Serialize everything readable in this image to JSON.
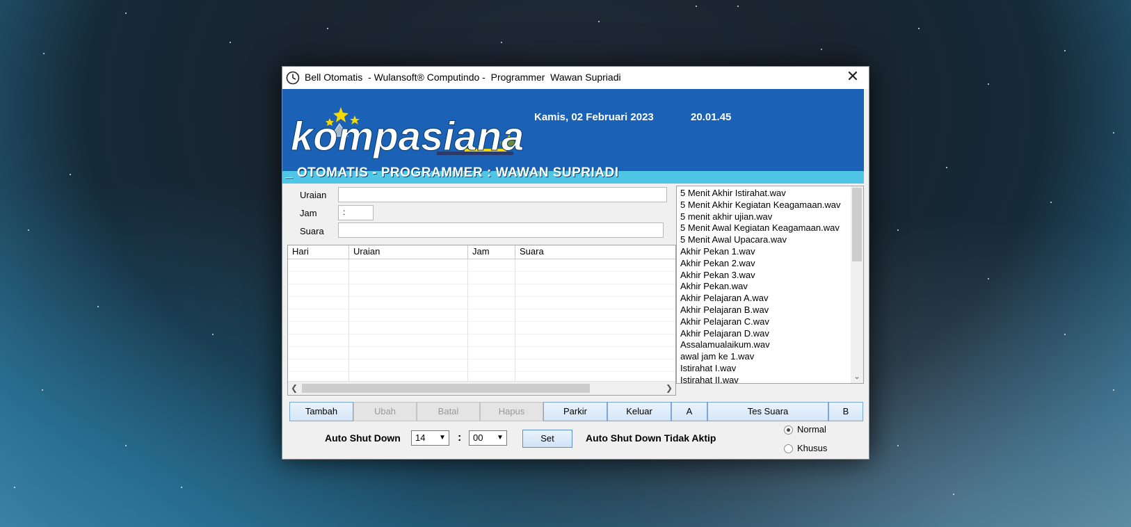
{
  "window": {
    "title": "Bell Otomatis  - Wulansoft® Computindo -  Programmer  Wawan Supriadi",
    "close_glyph": "✕"
  },
  "banner": {
    "logo_text": "kompasiana",
    "date": "Kamis, 02 Februari 2023",
    "time": "20.01.45",
    "marquee": "_ OTOMATIS - PROGRAMMER : WAWAN SUPRIADI"
  },
  "form": {
    "uraian_label": "Uraian",
    "jam_label": "Jam",
    "suara_label": "Suara",
    "uraian_value": "",
    "jam_value": ":",
    "suara_value": ""
  },
  "grid": {
    "columns": [
      "Hari",
      "Uraian",
      "Jam",
      "Suara"
    ],
    "rows": []
  },
  "files": [
    "5 Menit Akhir Istirahat.wav",
    "5 Menit Akhir Kegiatan Keagamaan.wav",
    "5 menit akhir ujian.wav",
    "5 Menit Awal Kegiatan Keagamaan.wav",
    "5 Menit Awal Upacara.wav",
    "Akhir Pekan 1.wav",
    "Akhir Pekan 2.wav",
    "Akhir Pekan 3.wav",
    "Akhir Pekan.wav",
    "Akhir Pelajaran A.wav",
    "Akhir Pelajaran B.wav",
    "Akhir Pelajaran C.wav",
    "Akhir Pelajaran D.wav",
    "Assalamualaikum.wav",
    "awal jam ke 1.wav",
    "Istirahat I.wav",
    "Istirahat II.wav"
  ],
  "buttons": {
    "tambah": "Tambah",
    "ubah": "Ubah",
    "batal": "Batal",
    "hapus": "Hapus",
    "parkir": "Parkir",
    "keluar": "Keluar",
    "a": "A",
    "tes_suara": "Tes Suara",
    "b": "B"
  },
  "shutdown": {
    "label": "Auto Shut Down",
    "hour": "14",
    "separator": ":",
    "minute": "00",
    "set_label": "Set",
    "status": "Auto Shut Down Tidak Aktip",
    "mode_normal": "Normal",
    "mode_khusus": "Khusus",
    "selected_mode": "Normal"
  },
  "colors": {
    "banner_blue": "#1b62b6",
    "banner_strip": "#4fc6e6",
    "button_border": "#7aa7d6"
  }
}
